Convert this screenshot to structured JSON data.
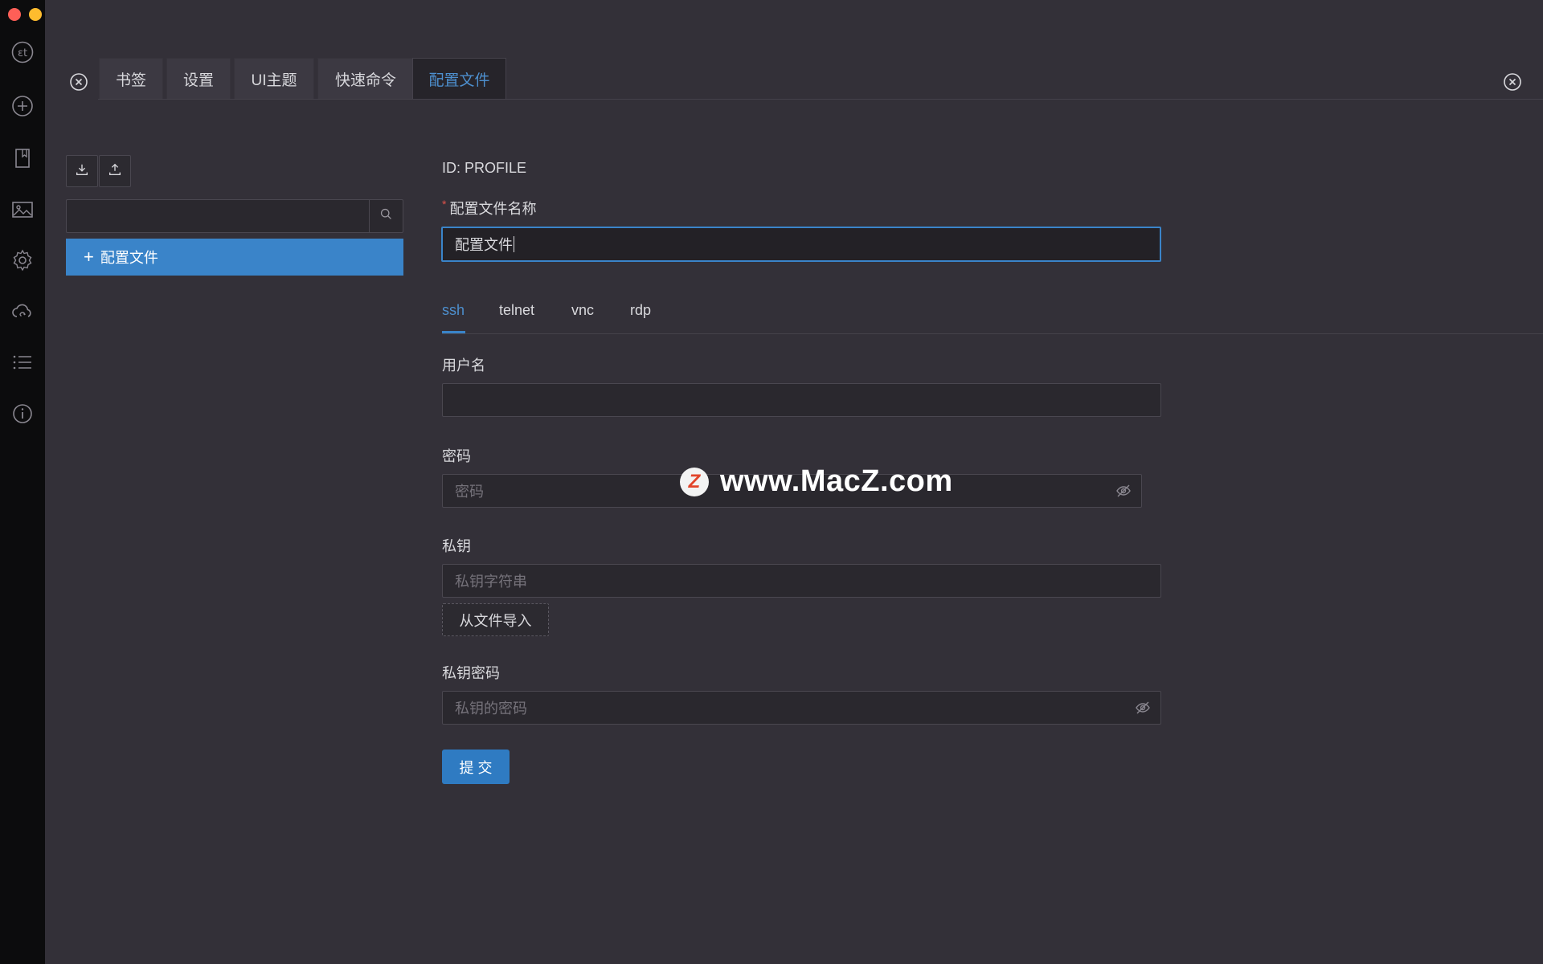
{
  "window": {
    "traffic_lights": {
      "close": "#ff5f57",
      "minimize": "#febc2e",
      "zoom": "#28c840"
    }
  },
  "sidebar": {
    "items": [
      {
        "icon": "logo-icon"
      },
      {
        "icon": "plus-circle-icon"
      },
      {
        "icon": "bookmark-icon"
      },
      {
        "icon": "image-icon"
      },
      {
        "icon": "gear-icon"
      },
      {
        "icon": "cloud-sync-icon"
      },
      {
        "icon": "list-icon"
      },
      {
        "icon": "info-icon"
      }
    ]
  },
  "tabs": [
    {
      "label": "书签"
    },
    {
      "label": "设置"
    },
    {
      "label": "UI主题"
    },
    {
      "label": "快速命令"
    },
    {
      "label": "配置文件",
      "active": true
    }
  ],
  "left_panel": {
    "search": {
      "value": ""
    },
    "profile_item": "配置文件",
    "add_symbol": "+"
  },
  "form": {
    "id_text": "ID: PROFILE",
    "required_mark": "*",
    "name_label": "配置文件名称",
    "name_value": "配置文件",
    "protocol_tabs": [
      "ssh",
      "telnet",
      "vnc",
      "rdp"
    ],
    "active_protocol": "ssh",
    "username_label": "用户名",
    "username_value": "",
    "password_label": "密码",
    "password_placeholder": "密码",
    "private_key_label": "私钥",
    "private_key_placeholder": "私钥字符串",
    "import_button": "从文件导入",
    "key_password_label": "私钥密码",
    "key_password_placeholder": "私钥的密码",
    "submit_button": "提 交"
  },
  "watermark": {
    "logo_letter": "Z",
    "text": "www.MacZ.com"
  },
  "colors": {
    "accent": "#3a84c9",
    "background": "#333038",
    "sidebar": "#0c0c0d"
  }
}
